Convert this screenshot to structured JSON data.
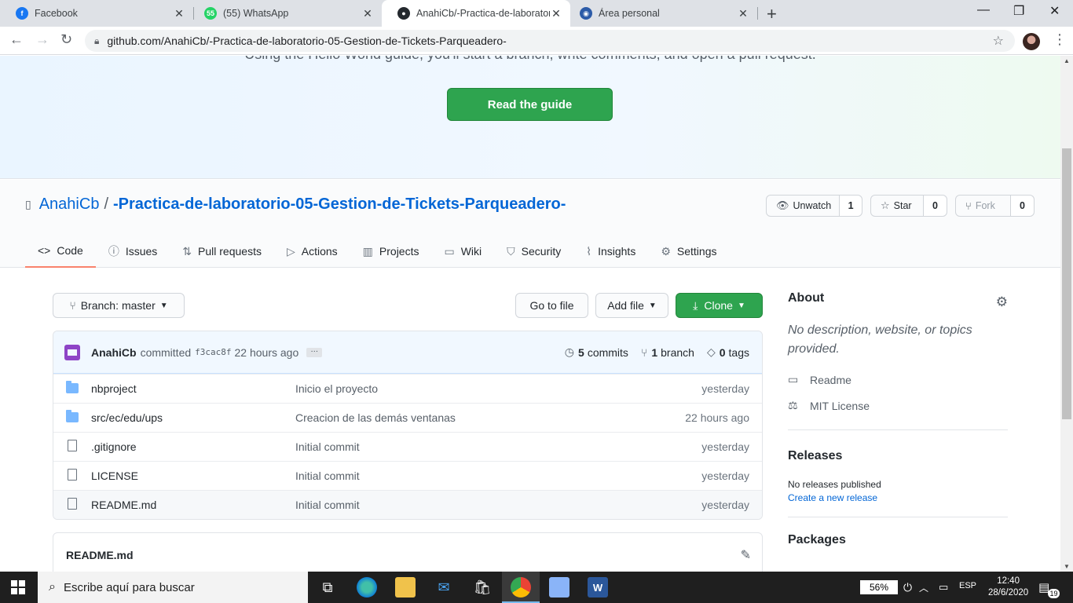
{
  "browser": {
    "tabs": [
      {
        "title": "Facebook",
        "favicon": "facebook-icon",
        "color": "#1877f2",
        "active": false
      },
      {
        "title": "(55) WhatsApp",
        "favicon": "whatsapp-icon",
        "color": "#25d366",
        "badge": "55",
        "active": false
      },
      {
        "title": "AnahiCb/-Practica-de-laboratorio",
        "favicon": "github-icon",
        "color": "#24292e",
        "active": true
      },
      {
        "title": "Área personal",
        "favicon": "moodle-icon",
        "color": "#2c5ba8",
        "active": false
      }
    ],
    "url": "github.com/AnahiCb/-Practica-de-laboratorio-05-Gestion-de-Tickets-Parqueadero-"
  },
  "banner": {
    "partial_text": "Using the Hello World guide, you'll start a branch, write comments, and open a pull request.",
    "button": "Read the guide",
    "button_color": "#2ea44f"
  },
  "repo": {
    "owner": "AnahiCb",
    "separator": "/",
    "name": "-Practica-de-laboratorio-05-Gestion-de-Tickets-Parqueadero-",
    "watch": {
      "label": "Unwatch",
      "count": "1"
    },
    "star": {
      "label": "Star",
      "count": "0"
    },
    "fork": {
      "label": "Fork",
      "count": "0"
    }
  },
  "nav": [
    {
      "label": "Code",
      "icon": "code-icon",
      "selected": true
    },
    {
      "label": "Issues",
      "icon": "issue-icon"
    },
    {
      "label": "Pull requests",
      "icon": "pull-request-icon"
    },
    {
      "label": "Actions",
      "icon": "play-icon"
    },
    {
      "label": "Projects",
      "icon": "project-icon"
    },
    {
      "label": "Wiki",
      "icon": "book-icon"
    },
    {
      "label": "Security",
      "icon": "shield-icon"
    },
    {
      "label": "Insights",
      "icon": "graph-icon"
    },
    {
      "label": "Settings",
      "icon": "gear-icon"
    }
  ],
  "toolbar": {
    "branch_prefix": "Branch:",
    "branch": "master",
    "go_to_file": "Go to file",
    "add_file": "Add file",
    "clone": "Clone"
  },
  "commit": {
    "author": "AnahiCb",
    "verb": "committed",
    "sha": "f3cac8f",
    "time": "22 hours ago",
    "commits_count": "5",
    "commits_label": "commits",
    "branches_count": "1",
    "branches_label": "branch",
    "tags_count": "0",
    "tags_label": "tags"
  },
  "files": [
    {
      "type": "folder",
      "name": "nbproject",
      "message": "Inicio el proyecto",
      "age": "yesterday"
    },
    {
      "type": "folder",
      "name": "src/ec/edu/ups",
      "message": "Creacion de las demás ventanas",
      "age": "22 hours ago"
    },
    {
      "type": "file",
      "name": ".gitignore",
      "message": "Initial commit",
      "age": "yesterday"
    },
    {
      "type": "file",
      "name": "LICENSE",
      "message": "Initial commit",
      "age": "yesterday"
    },
    {
      "type": "file",
      "name": "README.md",
      "message": "Initial commit",
      "age": "yesterday"
    }
  ],
  "readme": {
    "title": "README.md"
  },
  "sidebar": {
    "about_title": "About",
    "about_desc": "No description, website, or topics provided.",
    "readme_link": "Readme",
    "license_link": "MIT License",
    "releases_title": "Releases",
    "no_releases": "No releases published",
    "create_release": "Create a new release",
    "packages_title": "Packages"
  },
  "taskbar": {
    "search_placeholder": "Escribe aquí para buscar",
    "battery": "56%",
    "language": "ESP",
    "time": "12:40",
    "date": "28/6/2020",
    "notifications": "19"
  }
}
